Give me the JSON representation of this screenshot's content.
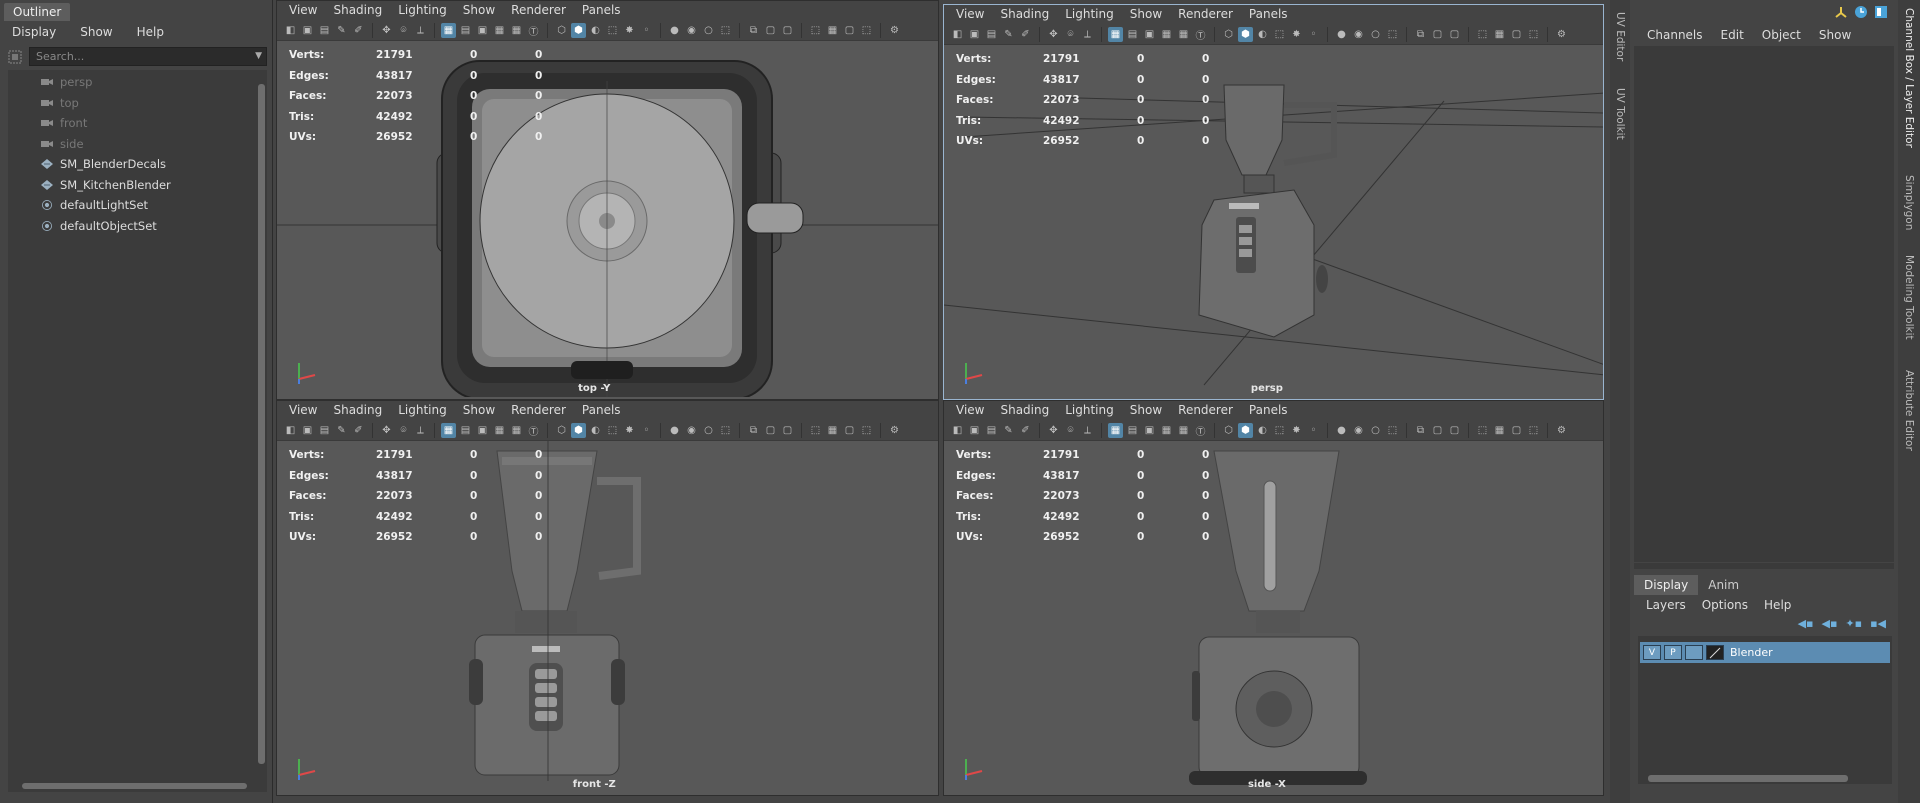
{
  "outliner": {
    "tab": "Outliner",
    "menu": [
      "Display",
      "Show",
      "Help"
    ],
    "search_placeholder": "Search...",
    "items": [
      {
        "label": "persp",
        "icon": "camera-icon",
        "dim": true
      },
      {
        "label": "top",
        "icon": "camera-icon",
        "dim": true
      },
      {
        "label": "front",
        "icon": "camera-icon",
        "dim": true
      },
      {
        "label": "side",
        "icon": "camera-icon",
        "dim": true
      },
      {
        "label": "SM_BlenderDecals",
        "icon": "mesh-icon",
        "dim": false
      },
      {
        "label": "SM_KitchenBlender",
        "icon": "mesh-icon",
        "dim": false
      },
      {
        "label": "defaultLightSet",
        "icon": "set-icon",
        "dim": false
      },
      {
        "label": "defaultObjectSet",
        "icon": "set-icon",
        "dim": false
      }
    ]
  },
  "viewport_menu": [
    "View",
    "Shading",
    "Lighting",
    "Show",
    "Renderer",
    "Panels"
  ],
  "hud": {
    "labels": [
      "Verts:",
      "Edges:",
      "Faces:",
      "Tris:",
      "UVs:"
    ],
    "values": [
      "21791",
      "43817",
      "22073",
      "42492",
      "26952"
    ],
    "col2": [
      "0",
      "0",
      "0",
      "0",
      "0"
    ],
    "col3": [
      "0",
      "0",
      "0",
      "0",
      "0"
    ]
  },
  "viewports": {
    "top": {
      "label": "top -Y"
    },
    "persp": {
      "label": "persp"
    },
    "front": {
      "label": "front -Z"
    },
    "side": {
      "label": "side -X"
    }
  },
  "side_tabs": {
    "uv_editor": "UV Editor",
    "uv_toolkit": "UV Toolkit",
    "channel_layer": "Channel Box / Layer Editor",
    "simplygon": "Simplygon",
    "modeling_toolkit": "Modeling Toolkit",
    "attribute_editor": "Attribute Editor"
  },
  "channel_box": {
    "menu": [
      "Channels",
      "Edit",
      "Object",
      "Show"
    ]
  },
  "layer_editor": {
    "tabs": [
      "Display",
      "Anim"
    ],
    "menu": [
      "Layers",
      "Options",
      "Help"
    ],
    "layer": {
      "v": "V",
      "p": "P",
      "name": "Blender"
    }
  },
  "colors": {
    "accent": "#5285a6",
    "layer_row": "#5c8cb2",
    "active_border": "#9ab5d0"
  }
}
